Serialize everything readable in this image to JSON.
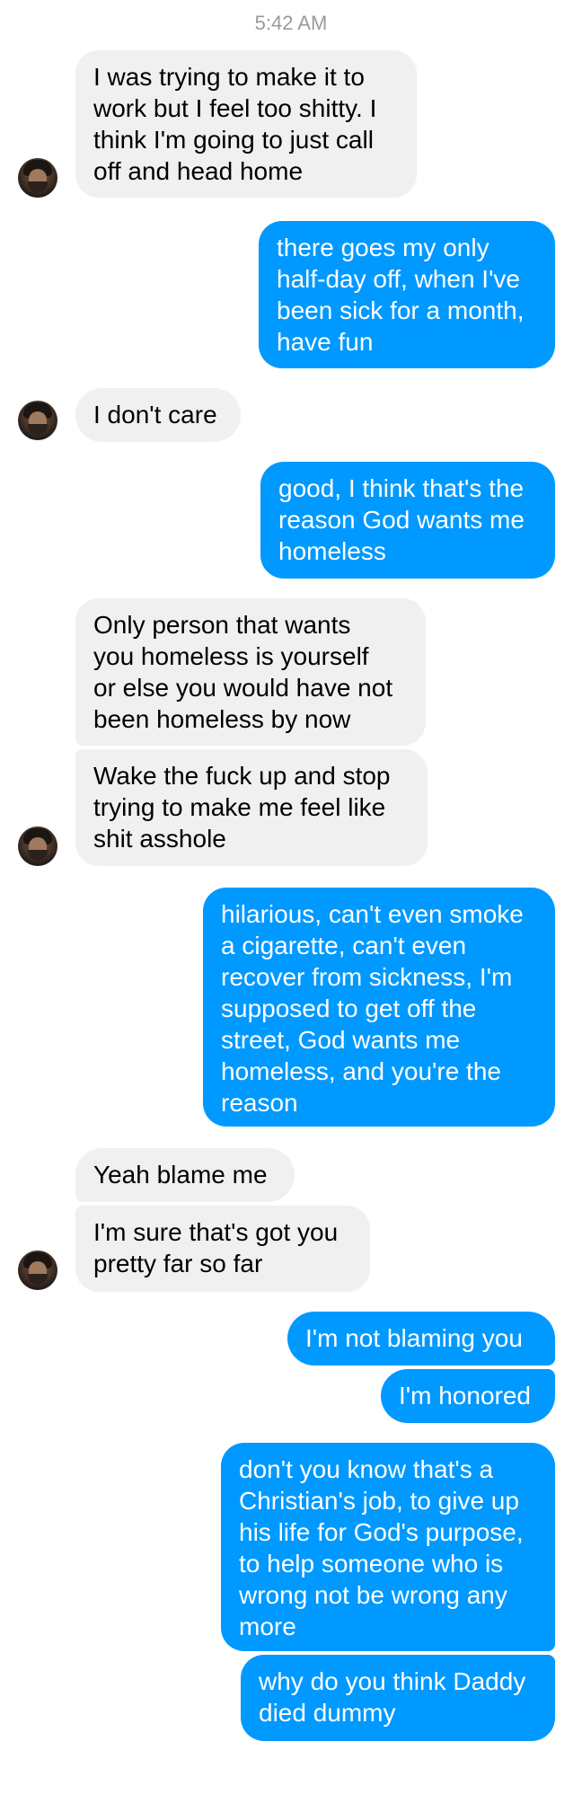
{
  "timestamp": "5:42 AM",
  "contact": {
    "avatar_icon": "contact-avatar"
  },
  "colors": {
    "incoming_bubble": "#f1f0f0",
    "outgoing_bubble": "#0099ff"
  },
  "messages": [
    {
      "from": "them",
      "lines": [
        "I was trying to make it to",
        "work but I feel too shitty. I",
        "think I'm going to just call",
        "off and head home"
      ]
    },
    {
      "from": "me",
      "lines": [
        "there goes my only",
        "half-day off, when I've",
        "been sick for a month,",
        "have fun"
      ]
    },
    {
      "from": "them",
      "lines": [
        "I don't care"
      ]
    },
    {
      "from": "me",
      "lines": [
        "good, I think that's the",
        "reason God wants me",
        "homeless"
      ]
    },
    {
      "from": "them",
      "lines": [
        "Only person that wants",
        "you homeless is yourself",
        "or else you would have not",
        "been homeless by now"
      ]
    },
    {
      "from": "them",
      "lines": [
        "Wake the fuck up and stop",
        "trying to make me feel like",
        "shit asshole"
      ]
    },
    {
      "from": "me",
      "lines": [
        "hilarious, can't even smoke",
        "a cigarette, can't even",
        "recover from sickness, I'm",
        "supposed to get off the",
        "street, God wants me",
        "homeless, and you're the",
        "reason"
      ]
    },
    {
      "from": "them",
      "lines": [
        "Yeah blame me"
      ]
    },
    {
      "from": "them",
      "lines": [
        "I'm sure that's got you",
        "pretty far so far"
      ]
    },
    {
      "from": "me",
      "lines": [
        "I'm not blaming you"
      ]
    },
    {
      "from": "me",
      "lines": [
        "I'm honored"
      ]
    },
    {
      "from": "me",
      "lines": [
        "don't you know that's a",
        "Christian's job, to give up",
        "his life for God's purpose,",
        "to help someone who is",
        "wrong not be wrong any",
        "more"
      ]
    },
    {
      "from": "me",
      "lines": [
        "why do you think Daddy",
        "died dummy"
      ]
    }
  ]
}
